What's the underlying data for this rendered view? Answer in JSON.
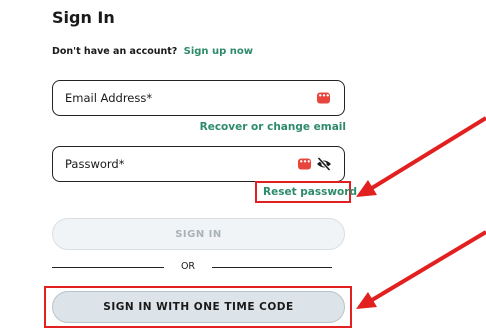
{
  "page": {
    "title": "Sign In",
    "signup_prompt": "Don't have an account?",
    "signup_link": "Sign up now"
  },
  "form": {
    "email_label": "Email Address*",
    "recover_link": "Recover or change email",
    "password_label": "Password*",
    "reset_link": "Reset password",
    "signin_button": "SIGN IN",
    "divider_text": "OR",
    "one_time_code_button": "SIGN IN WITH ONE TIME CODE"
  },
  "icons": {
    "password_manager": "password-manager-icon",
    "show_password": "eye-slash-icon"
  },
  "colors": {
    "link": "#2e8b69",
    "annotation": "#e32020",
    "password_manager": "#e8453c",
    "disabled_button": "#f1f4f6",
    "secondary_button": "#dde4e9"
  }
}
